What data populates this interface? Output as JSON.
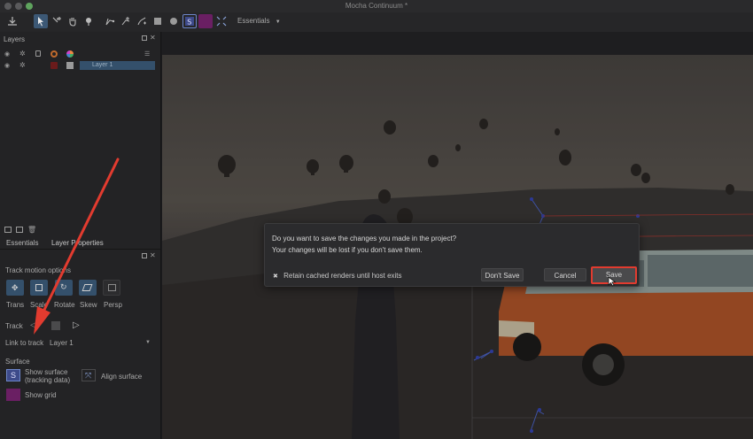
{
  "app": {
    "title": "Mocha Continuum *"
  },
  "toolbar": {
    "workspace_label": "Essentials"
  },
  "layers_panel": {
    "title": "Layers",
    "layer_name": "Layer 1"
  },
  "tabs": [
    {
      "label": "Essentials"
    },
    {
      "label": "Layer Properties"
    }
  ],
  "track_options": {
    "heading": "Track motion options",
    "buttons": [
      {
        "label": "Trans"
      },
      {
        "label": "Scale"
      },
      {
        "label": "Rotate"
      },
      {
        "label": "Skew"
      },
      {
        "label": "Persp"
      }
    ],
    "track_label": "Track",
    "link_label": "Link to track",
    "link_value": "Layer 1"
  },
  "surface": {
    "heading": "Surface",
    "show_surface_line1": "Show surface",
    "show_surface_line2": "(tracking data)",
    "align_surface": "Align surface",
    "show_grid": "Show grid"
  },
  "dialog": {
    "line1": "Do you want to save the changes you made in the project?",
    "line2": "Your changes will be lost if you don't save them.",
    "retain_label": "Retain cached renders until host exits",
    "dont_save": "Don't Save",
    "cancel": "Cancel",
    "save": "Save"
  },
  "colors": {
    "accent": "#34506b",
    "annotation": "#e23b2f",
    "purple": "#6a1f63"
  }
}
